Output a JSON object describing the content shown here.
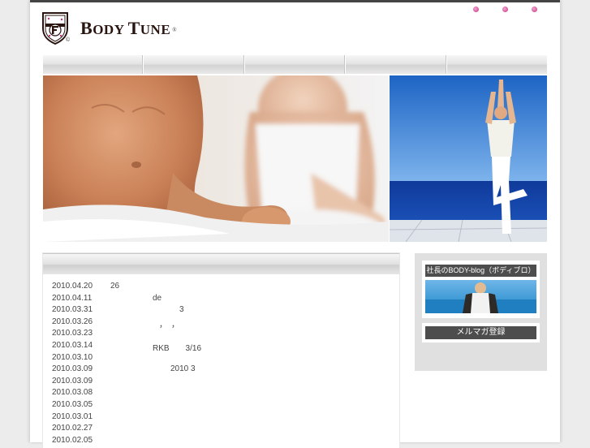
{
  "brand": {
    "name_first": "B",
    "name_rest": "ODY ",
    "name_second": "T",
    "name_second_rest": "UNE",
    "registered": "®",
    "copyright": "©"
  },
  "nav": {
    "item_count": 5
  },
  "news": {
    "items": [
      {
        "date": "2010.04.20",
        "text": "26",
        "offset": 72
      },
      {
        "date": "2010.04.11",
        "text": "de",
        "offset": 124
      },
      {
        "date": "2010.03.31",
        "text": "3",
        "offset": 157
      },
      {
        "date": "2010.03.26",
        "text": "，　，",
        "offset": 132
      },
      {
        "date": "2010.03.23",
        "text": "",
        "offset": 0
      },
      {
        "date": "2010.03.14",
        "text": "RKB　　3/16",
        "offset": 124
      },
      {
        "date": "2010.03.10",
        "text": "",
        "offset": 0
      },
      {
        "date": "2010.03.09",
        "text": "2010 3",
        "offset": 146
      },
      {
        "date": "2010.03.09",
        "text": "",
        "offset": 0
      },
      {
        "date": "2010.03.08",
        "text": "",
        "offset": 0
      },
      {
        "date": "2010.03.05",
        "text": "",
        "offset": 0
      },
      {
        "date": "2010.03.01",
        "text": "",
        "offset": 0
      },
      {
        "date": "2010.02.27",
        "text": "",
        "offset": 0
      },
      {
        "date": "2010.02.05",
        "text": "",
        "offset": 0
      }
    ]
  },
  "sidebar": {
    "blog_label": "社長のBODY-blog（ボディブロ）",
    "mailmag_label": "メルマガ登録"
  },
  "colors": {
    "dot_accent": "#c2317f",
    "dark_label": "#4d4d4d",
    "top_bar": "#444444"
  }
}
